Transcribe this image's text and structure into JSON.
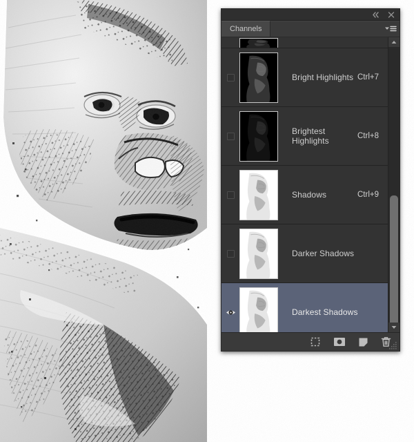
{
  "panel": {
    "title": "Channels",
    "tab_label": "Channels",
    "titlebar": {
      "collapse_icon": "double-chevron-left-icon",
      "close_icon": "close-icon"
    },
    "menu_icon": "panel-menu-icon",
    "channels": [
      {
        "name": "",
        "shortcut": "",
        "visible": false,
        "selected": false,
        "thumb": "dark",
        "clipped": true
      },
      {
        "name": "Bright Highlights",
        "shortcut": "Ctrl+7",
        "visible": false,
        "selected": false,
        "thumb": "very-dark"
      },
      {
        "name": "Brightest Highlights",
        "shortcut": "Ctrl+8",
        "visible": false,
        "selected": false,
        "thumb": "darkest"
      },
      {
        "name": "Shadows",
        "shortcut": "Ctrl+9",
        "visible": false,
        "selected": false,
        "thumb": "light"
      },
      {
        "name": "Darker Shadows",
        "shortcut": "",
        "visible": false,
        "selected": false,
        "thumb": "light"
      },
      {
        "name": "Darkest Shadows",
        "shortcut": "",
        "visible": true,
        "selected": true,
        "thumb": "light"
      }
    ],
    "footer_buttons": [
      {
        "name": "load-channel-as-selection",
        "icon": "dashed-square-icon"
      },
      {
        "name": "save-selection-as-channel",
        "icon": "filled-circle-in-square-icon"
      },
      {
        "name": "create-new-channel",
        "icon": "new-page-icon"
      },
      {
        "name": "delete-channel",
        "icon": "trash-icon"
      }
    ],
    "scrollbar": {
      "up_arrow_icon": "scroll-up-arrow-icon",
      "down_arrow_icon": "scroll-down-arrow-icon"
    },
    "resize_grip_icon": "resize-grip-icon"
  },
  "canvas": {
    "artwork_description": "pencil-sketch gorilla portrait"
  },
  "colors": {
    "panel_bg": "#383838",
    "row_bg": "#333333",
    "selected_row_bg": "#5b6378",
    "text": "#cfcfcf",
    "tab_active_bg": "#474747"
  }
}
